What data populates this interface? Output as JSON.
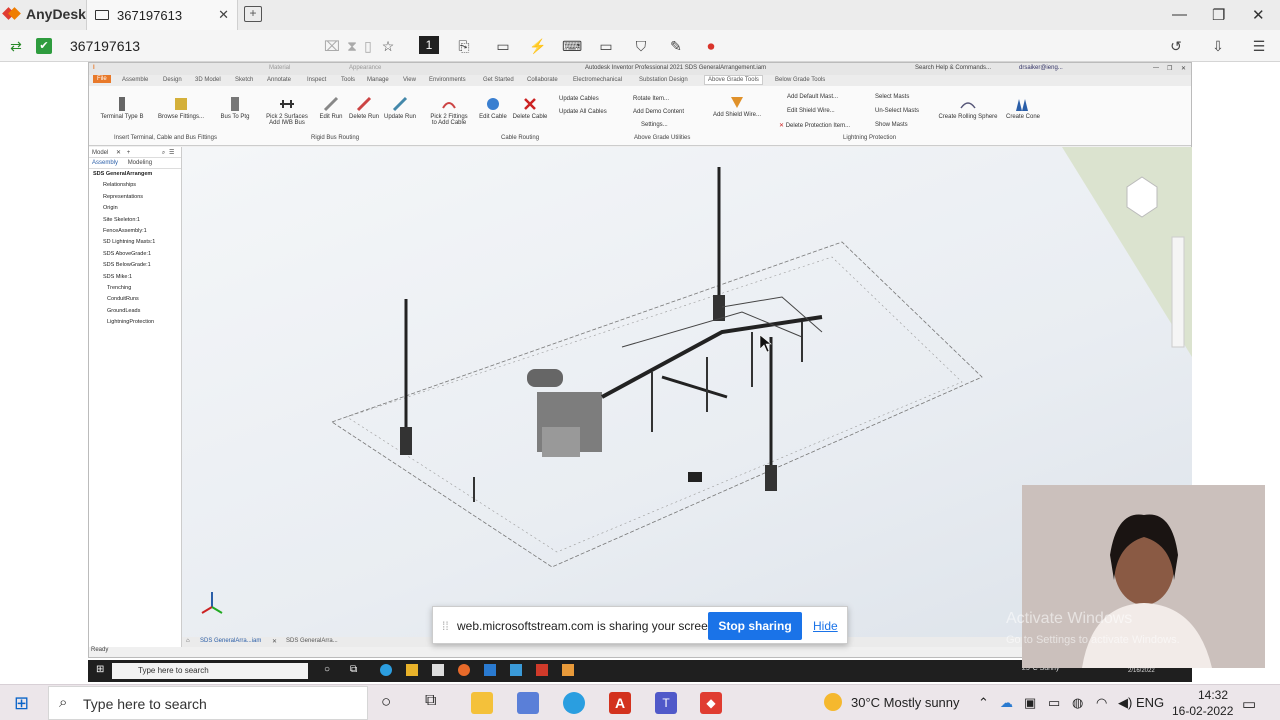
{
  "anydesk": {
    "app_name": "AnyDesk",
    "tab_title": "367197613",
    "address_id": "367197613",
    "monitor_number": "1"
  },
  "inventor": {
    "title": "Autodesk Inventor Professional 2021   SDS GeneralArrangement.iam",
    "search_placeholder": "Search Help & Commands...",
    "user": "drsaiker@ieng...",
    "material": "Material",
    "appearance": "Appearance",
    "ribbon_tabs": [
      "File",
      "Assemble",
      "Design",
      "3D Model",
      "Sketch",
      "Annotate",
      "Inspect",
      "Tools",
      "Manage",
      "View",
      "Environments",
      "Get Started",
      "Collaborate",
      "Electromechanical",
      "Substation Design",
      "Above Grade Tools",
      "Below Grade Tools"
    ],
    "active_tab": "Above Grade Tools",
    "buttons": {
      "terminal_type_b": "Terminal Type B",
      "browse_fittings": "Browse Fittings...",
      "bus_to_ptg": "Bus To Ptg",
      "pick2_surfaces": "Pick 2 Surfaces",
      "add_iwb_bus": "Add IWB Bus",
      "edit_run": "Edit Run",
      "delete_run": "Delete Run",
      "update_run": "Update Run",
      "pick2_fittings": "Pick 2 Fittings",
      "to_add_cable": "to Add Cable",
      "edit_cable": "Edit Cable",
      "delete_cable": "Delete Cable",
      "update_cables": "Update Cables",
      "update_all_cables": "Update All Cables",
      "rotate_item": "Rotate Item...",
      "add_demo_content": "Add Demo Content",
      "settings": "Settings...",
      "add_shield_wire": "Add Shield Wire...",
      "add_default_mast": "Add Default Mast...",
      "edit_shield_wire": "Edit Shield Wire...",
      "delete_protection_item": "Delete Protection Item...",
      "select_masts": "Select Masts",
      "unselect_masts": "Un-Select Masts",
      "show_masts": "Show Masts",
      "create_rolling_sphere": "Create Rolling Sphere",
      "create_cone": "Create Cone"
    },
    "groups": {
      "g1": "Insert Terminal, Cable and Bus Fittings",
      "g2": "Rigid Bus Routing",
      "g3": "Cable Routing",
      "g4": "Above Grade Utilities",
      "g5": "Lightning Protection"
    },
    "browser": {
      "header": "Model",
      "tab_assembly": "Assembly",
      "tab_modeling": "Modeling",
      "items": [
        "SDS GeneralArrangem",
        "Relationships",
        "Representations",
        "Origin",
        "Site Skeleton:1",
        "FenceAssembly:1",
        "SD Lightning Masts:1",
        "SDS AboveGrade:1",
        "SDS BelowGrade:1",
        "SDS Mike:1",
        "Trenching",
        "ConduitRuns",
        "GroundLeads",
        "LightningProtection"
      ]
    },
    "doc_tabs": [
      "SDS GeneralArra...iam",
      "SDS GeneralArra..."
    ],
    "status": "Ready"
  },
  "share_banner": {
    "message": "web.microsoftstream.com is sharing your screen.",
    "stop_label": "Stop sharing",
    "hide_label": "Hide"
  },
  "remote_taskbar": {
    "search_placeholder": "Type here to search",
    "weather": "25°C  Sunny",
    "date": "2/16/2022"
  },
  "watermark": {
    "line1": "Activate Windows",
    "line2": "Go to Settings to activate Windows."
  },
  "taskbar": {
    "search_placeholder": "Type here to search",
    "weather": "30°C  Mostly sunny",
    "language": "ENG",
    "time": "14:32",
    "date": "16-02-2022"
  }
}
